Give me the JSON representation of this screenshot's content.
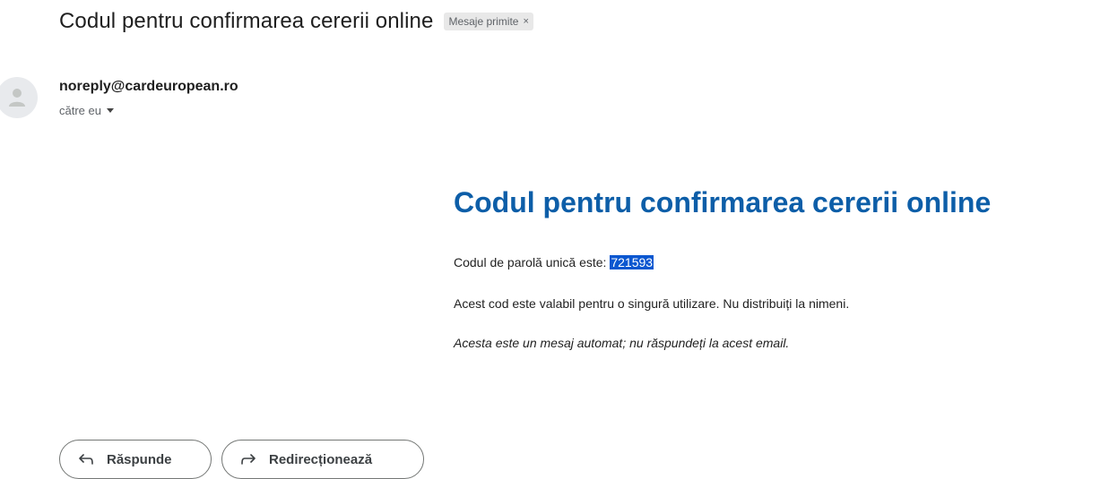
{
  "email": {
    "subject": "Codul pentru confirmarea cererii online",
    "label": "Mesaje primite",
    "label_remove": "×",
    "sender": "noreply@cardeuropean.ro",
    "recipient": "către eu",
    "body": {
      "heading": "Codul pentru confirmarea cererii online",
      "otp_prefix": "Codul de parolă unică este: ",
      "otp_code": "721593",
      "validity": "Acest cod este valabil pentru o singură utilizare. Nu distribuiți la nimeni.",
      "automated_note": "Acesta este un mesaj automat; nu răspundeți la acest email."
    }
  },
  "actions": {
    "reply_label": "Răspunde",
    "forward_label": "Redirecționează"
  },
  "colors": {
    "heading": "#0d5ea8",
    "otp_highlight": "#0b57d0"
  }
}
